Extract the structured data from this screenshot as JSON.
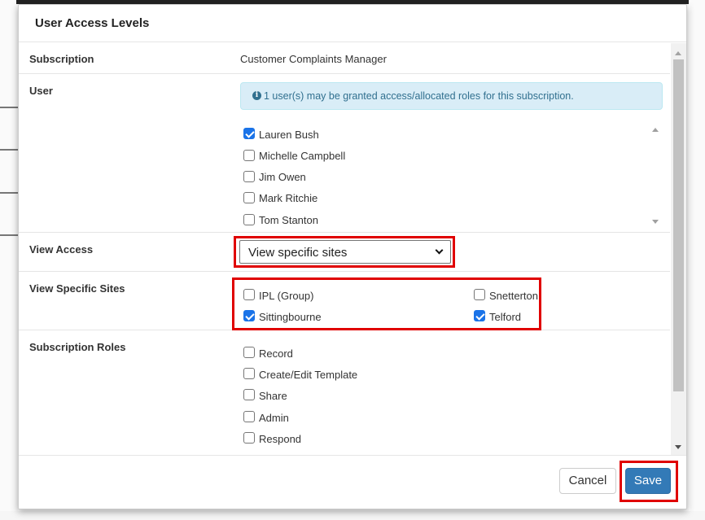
{
  "dialog": {
    "title": "User Access Levels"
  },
  "subscription": {
    "label": "Subscription",
    "value": "Customer Complaints Manager"
  },
  "user": {
    "label": "User",
    "info_icon": "info-circle-icon",
    "info_text": "1 user(s) may be granted access/allocated roles for this subscription.",
    "items": [
      {
        "label": "Lauren Bush",
        "checked": true
      },
      {
        "label": "Michelle Campbell",
        "checked": false
      },
      {
        "label": "Jim Owen",
        "checked": false
      },
      {
        "label": "Mark Ritchie",
        "checked": false
      },
      {
        "label": "Tom Stanton",
        "checked": false
      }
    ]
  },
  "view_access": {
    "label": "View Access",
    "selected": "View specific sites"
  },
  "view_specific_sites": {
    "label": "View Specific Sites",
    "items": [
      {
        "label": "IPL (Group)",
        "checked": false
      },
      {
        "label": "Snetterton",
        "checked": false
      },
      {
        "label": "Sittingbourne",
        "checked": true
      },
      {
        "label": "Telford",
        "checked": true
      }
    ]
  },
  "subscription_roles": {
    "label": "Subscription Roles",
    "items": [
      {
        "label": "Record",
        "checked": false
      },
      {
        "label": "Create/Edit Template",
        "checked": false
      },
      {
        "label": "Share",
        "checked": false
      },
      {
        "label": "Admin",
        "checked": false
      },
      {
        "label": "Respond",
        "checked": false
      }
    ]
  },
  "footer": {
    "cancel_label": "Cancel",
    "save_label": "Save"
  },
  "colors": {
    "highlight": "#e00000",
    "primary_button": "#337ab7",
    "checkbox_checked": "#1a73e8",
    "info_background": "#d9edf7",
    "info_text": "#31708f"
  }
}
